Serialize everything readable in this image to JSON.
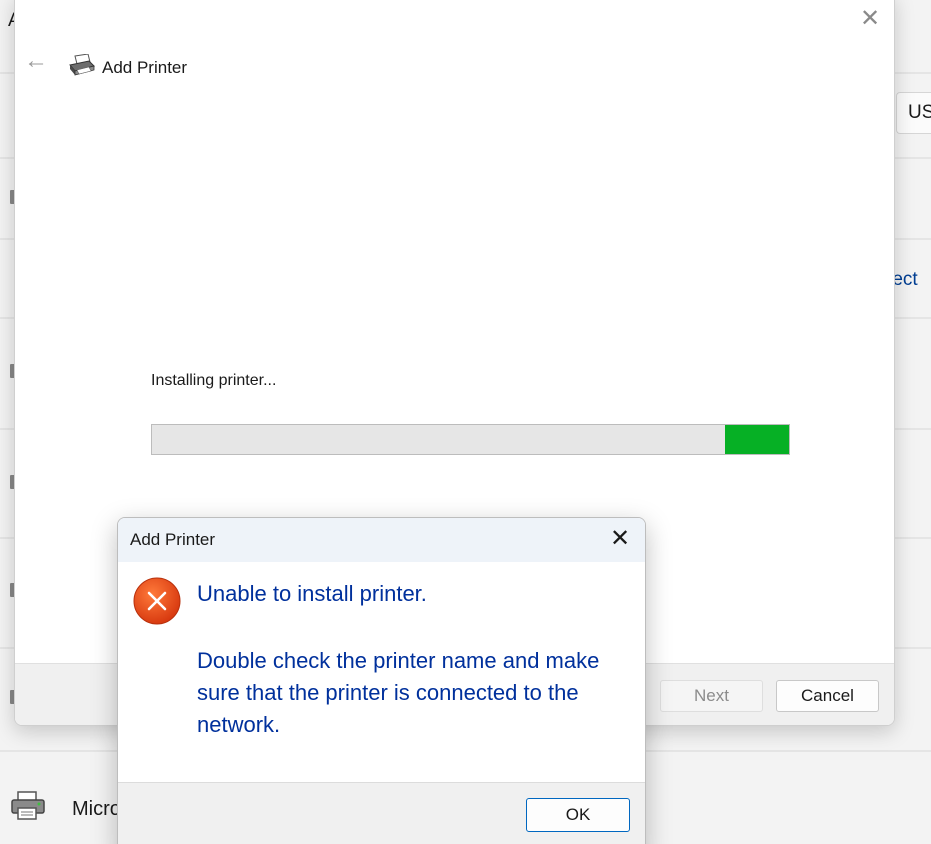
{
  "background": {
    "top_letter": "A",
    "region_value": "US",
    "link_fragment": "rect",
    "list_item_fragment": "Micro"
  },
  "wizard": {
    "title": "Add Printer",
    "close_glyph": "✕",
    "back_glyph": "←",
    "status_text": "Installing printer...",
    "progress_percent": 10,
    "progress_color": "#06b025",
    "next_label": "Next",
    "cancel_label": "Cancel",
    "icons": {
      "back": "back-arrow-icon",
      "printer": "printer-icon",
      "close": "close-icon"
    }
  },
  "dialog": {
    "title": "Add Printer",
    "close_glyph": "✕",
    "message": "Unable to install printer.",
    "detail": "Double check the printer name and make sure that the printer is connected to the network.",
    "ok_label": "OK",
    "text_color": "#00309c",
    "icon": "error-icon"
  }
}
